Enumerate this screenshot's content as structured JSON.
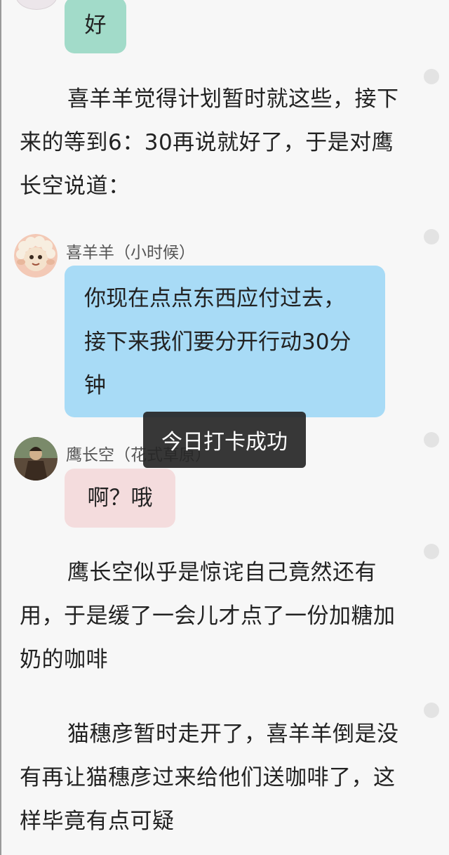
{
  "messages": [
    {
      "type": "reply",
      "text": "好"
    },
    {
      "type": "narration",
      "text": "喜羊羊觉得计划暂时就这些，接下来的等到6：30再说就好了，于是对鹰长空说道："
    },
    {
      "type": "dialogue",
      "speaker": "喜羊羊（小时候）",
      "avatar": "sheep-avatar-icon",
      "text": "你现在点点东西应付过去，接下来我们要分开行动30分钟"
    },
    {
      "type": "dialogue",
      "speaker": "鹰长空（花式草原）",
      "avatar": "eagle-avatar-icon",
      "text": "啊？哦"
    },
    {
      "type": "narration",
      "text": "鹰长空似乎是惊诧自己竟然还有用，于是缓了一会儿才点了一份加糖加奶的咖啡"
    },
    {
      "type": "narration",
      "text": "猫穗彦暂时走开了，喜羊羊倒是没有再让猫穗彦过来给他们送咖啡了，这样毕竟有点可疑"
    }
  ],
  "toast": {
    "text": "今日打卡成功"
  },
  "colors": {
    "reply_bubble": "#a2dbc9",
    "sheep_bubble": "#a8dbf6",
    "eagle_bubble": "#f4dcdd",
    "toast_bg": "#262626"
  }
}
